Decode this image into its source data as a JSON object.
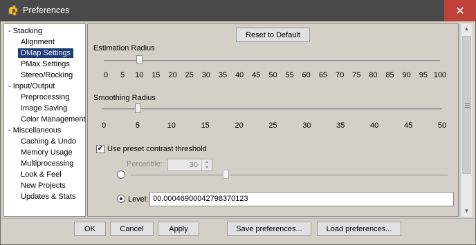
{
  "window": {
    "title": "Preferences",
    "close_glyph": "✕"
  },
  "tree": {
    "items": [
      {
        "label": "- Stacking",
        "kind": "group"
      },
      {
        "label": "Alignment",
        "kind": "child"
      },
      {
        "label": "DMap Settings",
        "kind": "child",
        "selected": true
      },
      {
        "label": "PMax Settings",
        "kind": "child"
      },
      {
        "label": "Stereo/Rocking",
        "kind": "child"
      },
      {
        "label": "- Input/Output",
        "kind": "group"
      },
      {
        "label": "Preprocessing",
        "kind": "child"
      },
      {
        "label": "Image Saving",
        "kind": "child"
      },
      {
        "label": "Color Management",
        "kind": "child"
      },
      {
        "label": "- Miscellaneous",
        "kind": "group"
      },
      {
        "label": "Caching & Undo",
        "kind": "child"
      },
      {
        "label": "Memory Usage",
        "kind": "child"
      },
      {
        "label": "Multiprocessing",
        "kind": "child"
      },
      {
        "label": "Look & Feel",
        "kind": "child"
      },
      {
        "label": "New Projects",
        "kind": "child"
      },
      {
        "label": "Updates & Stats",
        "kind": "child"
      }
    ]
  },
  "dmap": {
    "reset_label": "Reset to Default",
    "estimation": {
      "label": "Estimation Radius",
      "value": 10,
      "min": 0,
      "max": 100,
      "ticks": [
        "0",
        "5",
        "10",
        "15",
        "20",
        "25",
        "30",
        "35",
        "40",
        "45",
        "50",
        "55",
        "60",
        "65",
        "70",
        "75",
        "80",
        "85",
        "90",
        "95",
        "100"
      ]
    },
    "smoothing": {
      "label": "Smoothing Radius",
      "value": 5,
      "min": 0,
      "max": 50,
      "ticks": [
        "0",
        "5",
        "10",
        "15",
        "20",
        "25",
        "30",
        "35",
        "40",
        "45",
        "50"
      ]
    },
    "contrast": {
      "checkbox_label": "Use preset contrast threshold",
      "checked": true,
      "check_glyph": "✔",
      "percentile_label": "Percentile:",
      "percentile_value": "30",
      "percentile_slider_value": 30,
      "level_label": "Level:",
      "level_value": "00.00046900042798370123",
      "selected_mode": "level"
    }
  },
  "footer": {
    "ok_label": "OK",
    "cancel_label": "Cancel",
    "apply_label": "Apply",
    "save_label": "Save preferences...",
    "load_label": "Load preferences..."
  },
  "scrollbar": {
    "up_glyph": "▲",
    "down_glyph": "▼"
  },
  "colors": {
    "titlebar": "#4a4a4a",
    "close": "#c0413a",
    "selection": "#1e3d78"
  }
}
